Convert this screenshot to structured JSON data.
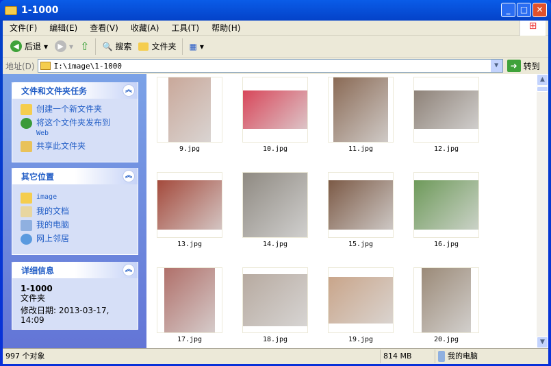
{
  "window": {
    "title": "1-1000"
  },
  "menu": [
    "文件(F)",
    "编辑(E)",
    "查看(V)",
    "收藏(A)",
    "工具(T)",
    "帮助(H)"
  ],
  "toolbar": {
    "back": "后退",
    "search": "搜索",
    "folders": "文件夹"
  },
  "address": {
    "label": "地址(D)",
    "value": "I:\\image\\1-1000",
    "go": "转到"
  },
  "tasks": {
    "title": "文件和文件夹任务",
    "items": [
      "创建一个新文件夹",
      "将这个文件夹发布到",
      "Web",
      "共享此文件夹"
    ]
  },
  "places": {
    "title": "其它位置",
    "items": [
      "image",
      "我的文档",
      "我的电脑",
      "网上邻居"
    ]
  },
  "details": {
    "title": "详细信息",
    "name": "1-1000",
    "type": "文件夹",
    "modified": "修改日期: 2013-03-17,",
    "time": "14:09"
  },
  "files": [
    {
      "name": "9.jpg",
      "color": "#c9a89a"
    },
    {
      "name": "10.jpg",
      "color": "#d8475a"
    },
    {
      "name": "11.jpg",
      "color": "#8a6a55"
    },
    {
      "name": "12.jpg",
      "color": "#8e8278"
    },
    {
      "name": "13.jpg",
      "color": "#a44a3c"
    },
    {
      "name": "14.jpg",
      "color": "#8f8a82"
    },
    {
      "name": "15.jpg",
      "color": "#7c5a46"
    },
    {
      "name": "16.jpg",
      "color": "#6e9a5a"
    },
    {
      "name": "17.jpg",
      "color": "#b0706a"
    },
    {
      "name": "18.jpg",
      "color": "#b7aaa0"
    },
    {
      "name": "19.jpg",
      "color": "#c9a58a"
    },
    {
      "name": "20.jpg",
      "color": "#9b8a78"
    }
  ],
  "status": {
    "count": "997 个对象",
    "size": "814 MB",
    "location": "我的电脑"
  }
}
